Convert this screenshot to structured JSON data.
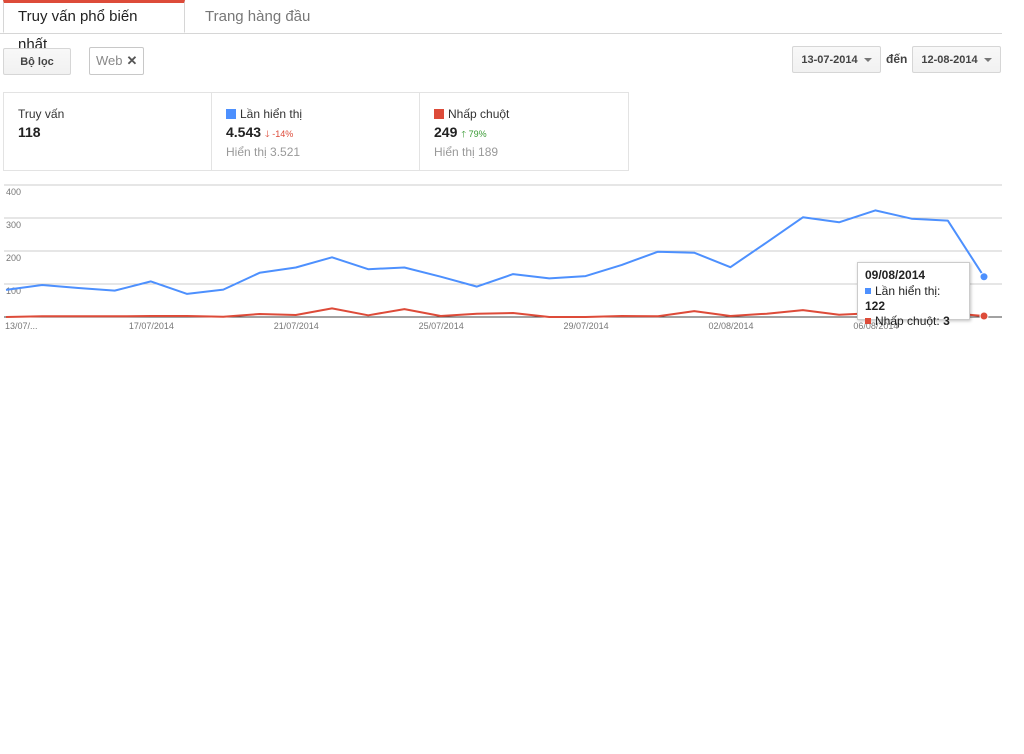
{
  "tabs": [
    {
      "label": "Truy vấn phổ biến nhất",
      "active": true
    },
    {
      "label": "Trang hàng đầu",
      "active": false
    }
  ],
  "toolbar": {
    "filter_label": "Bộ lọc",
    "chip_label": "Web",
    "chip_close": "✕",
    "date_from": "13-07-2014",
    "to_label": "đến",
    "date_to": "12-08-2014"
  },
  "stats": {
    "queries": {
      "label": "Truy vấn",
      "value": "118"
    },
    "impressions": {
      "label": "Lần hiển thị",
      "value": "4.543",
      "change": "-14%",
      "arrow": "🡓",
      "sub": "Hiển thị 3.521",
      "color": "#4d90fe"
    },
    "clicks": {
      "label": "Nhấp chuột",
      "value": "249",
      "change": "79%",
      "arrow": "🡑",
      "sub": "Hiển thị 189",
      "color": "#dd4b39"
    }
  },
  "chart_data": {
    "type": "line",
    "y_ticks": [
      "400",
      "300",
      "200",
      "100"
    ],
    "ylim": [
      0,
      400
    ],
    "x_labels": [
      "13/07/...",
      "17/07/2014",
      "21/07/2014",
      "25/07/2014",
      "29/07/2014",
      "02/08/2014",
      "06/08/2014"
    ],
    "x_label_index": [
      0,
      4,
      8,
      12,
      16,
      20,
      24
    ],
    "series": [
      {
        "name": "Lần hiển thị",
        "color": "#4d90fe",
        "values": [
          82,
          97,
          88,
          80,
          108,
          70,
          83,
          134,
          150,
          181,
          145,
          150,
          122,
          92,
          130,
          117,
          124,
          158,
          198,
          195,
          151,
          226,
          302,
          287,
          323,
          298,
          292,
          122
        ]
      },
      {
        "name": "Nhấp chuột",
        "color": "#dd4b39",
        "values": [
          0,
          2,
          2,
          2,
          3,
          3,
          1,
          9,
          6,
          26,
          5,
          24,
          3,
          10,
          12,
          0,
          0,
          3,
          2,
          18,
          3,
          10,
          21,
          7,
          12,
          14,
          12,
          3
        ]
      }
    ]
  },
  "tooltip": {
    "date": "09/08/2014",
    "impressions_label": "Lần hiển thị:",
    "impressions_value": "122",
    "clicks_label": "Nhấp chuột:",
    "clicks_value": "3"
  }
}
